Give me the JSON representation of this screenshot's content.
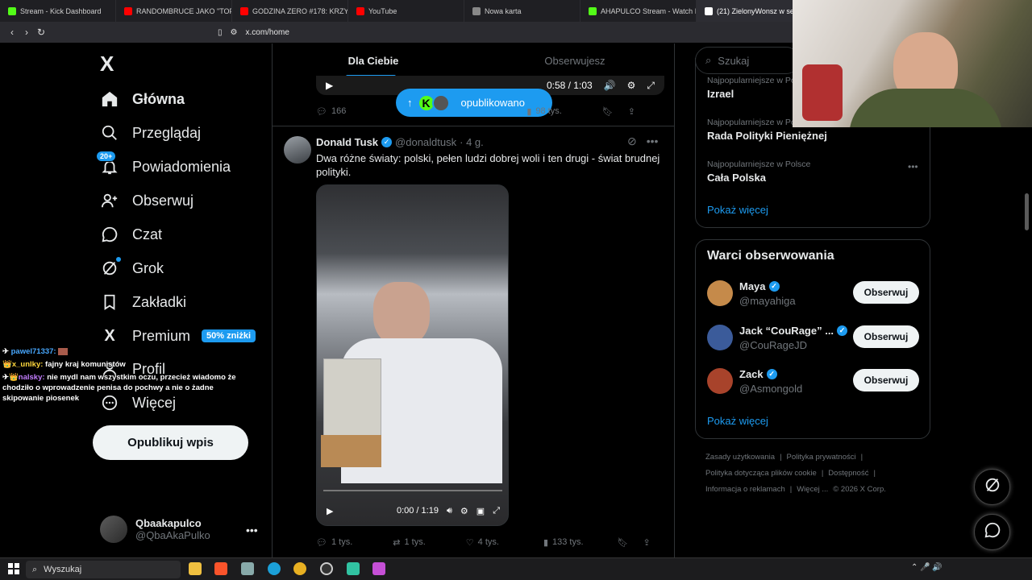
{
  "browser": {
    "tabs": [
      {
        "label": "Stream - Kick Dashboard",
        "color": "#53fc18"
      },
      {
        "label": "RANDOMBRUCE JAKO \"TOP 1\"",
        "color": "#ff0000"
      },
      {
        "label": "GODZINA ZERO #178: KRZYSZ",
        "color": "#ff0000"
      },
      {
        "label": "YouTube",
        "color": "#ff0000"
      },
      {
        "label": "Nowa karta",
        "color": "#888888"
      },
      {
        "label": "AHAPULCO Stream - Watch Liv",
        "color": "#53fc18"
      },
      {
        "label": "(21) ZielonyWonsz w serwisie",
        "color": "#ffffff"
      }
    ],
    "url": "x.com/home"
  },
  "sidebar": {
    "logo": "X",
    "items": [
      {
        "label": "Główna",
        "icon": "home-icon"
      },
      {
        "label": "Przeglądaj",
        "icon": "search-icon"
      },
      {
        "label": "Powiadomienia",
        "icon": "bell-icon",
        "badge": "20+"
      },
      {
        "label": "Obserwuj",
        "icon": "follow-icon"
      },
      {
        "label": "Czat",
        "icon": "chat-icon"
      },
      {
        "label": "Grok",
        "icon": "grok-icon"
      },
      {
        "label": "Zakładki",
        "icon": "bookmark-icon"
      },
      {
        "label": "Premium",
        "icon": "x-premium-icon",
        "promo": "50% zniżki"
      },
      {
        "label": "Profil",
        "icon": "profile-icon"
      },
      {
        "label": "Więcej",
        "icon": "more-icon"
      }
    ],
    "post_button": "Opublikuj wpis",
    "profile": {
      "name": "Qbaakapulco",
      "handle": "@QbaAkaPulko"
    }
  },
  "chat_overlay": [
    {
      "user": "pawel71337:",
      "text": ""
    },
    {
      "user": "x_unlky:",
      "text": "fajny kraj komunistów"
    },
    {
      "user": "nalsky:",
      "text": "nie mydl nam wszystkim oczu, przecież wiadomo że chodziło o wprowadzenie penisa do pochwy a nie o żadne skipowanie piosenek"
    }
  ],
  "feed": {
    "tabs": [
      "Dla Ciebie",
      "Obserwujesz"
    ],
    "prev_video_time": "0:58 / 1:03",
    "toast": "opublikowano",
    "prev_actions": {
      "replies": "166",
      "views": "98 tys."
    },
    "tweet": {
      "author": "Donald Tusk",
      "handle": "@donaldtusk",
      "time": "· 4 g.",
      "text": "Dwa różne światy: polski, pełen ludzi dobrej woli i ten drugi - świat brudnej polityki.",
      "video_time": "0:00 / 1:19",
      "replies": "1 tys.",
      "reposts": "1 tys.",
      "likes": "4 tys.",
      "views": "133 tys."
    }
  },
  "right": {
    "search_placeholder": "Szukaj",
    "trends": [
      {
        "context": "Najpopularniejsze w Polsce",
        "title": "Izrael"
      },
      {
        "context": "Najpopularniejsze w Polsce",
        "title": "Rada Polityki Pieniężnej"
      },
      {
        "context": "Najpopularniejsze w Polsce",
        "title": "Cała Polska"
      }
    ],
    "show_more": "Pokaż więcej",
    "wtf_title": "Warci obserwowania",
    "who_to_follow": [
      {
        "name": "Maya",
        "handle": "@mayahiga",
        "button": "Obserwuj",
        "color": "#c58a4a"
      },
      {
        "name": "Jack “CouRage” ...",
        "handle": "@CouRageJD",
        "button": "Obserwuj",
        "color": "#3b5b9a"
      },
      {
        "name": "Zack",
        "handle": "@Asmongold",
        "button": "Obserwuj",
        "color": "#a8432b"
      }
    ],
    "show_more_2": "Pokaż więcej",
    "footer": [
      "Zasady użytkowania",
      "Polityka prywatności",
      "Polityka dotycząca plików cookie",
      "Dostępność",
      "Informacja o reklamach",
      "Więcej ...",
      "© 2026 X Corp."
    ]
  },
  "taskbar": {
    "search": "Wyszukaj"
  }
}
